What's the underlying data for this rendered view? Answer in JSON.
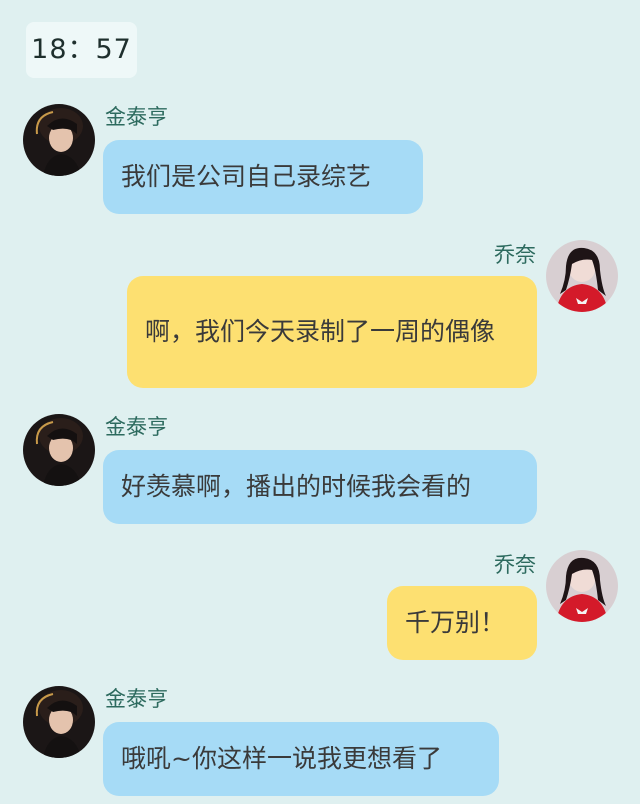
{
  "chat": {
    "time": "18：57",
    "messages": [
      {
        "sender": "金泰亨",
        "text": "我们是公司自己录综艺",
        "side": "left"
      },
      {
        "sender": "乔奈",
        "text": "啊，我们今天录制了一周的偶像",
        "side": "right"
      },
      {
        "sender": "金泰亨",
        "text": "好羡慕啊，播出的时候我会看的",
        "side": "left"
      },
      {
        "sender": "乔奈",
        "text": "千万别！",
        "side": "right"
      },
      {
        "sender": "金泰亨",
        "text": "哦吼~你这样一说我更想看了",
        "side": "left"
      }
    ]
  },
  "colors": {
    "background": "#dff0f0",
    "left_bubble": "#a6dbf6",
    "right_bubble": "#fde071",
    "name_text": "#2c6a5e",
    "message_text": "#3a3a3a"
  },
  "icons": {
    "left_avatar": "male-avatar-icon",
    "right_avatar": "female-avatar-icon"
  }
}
